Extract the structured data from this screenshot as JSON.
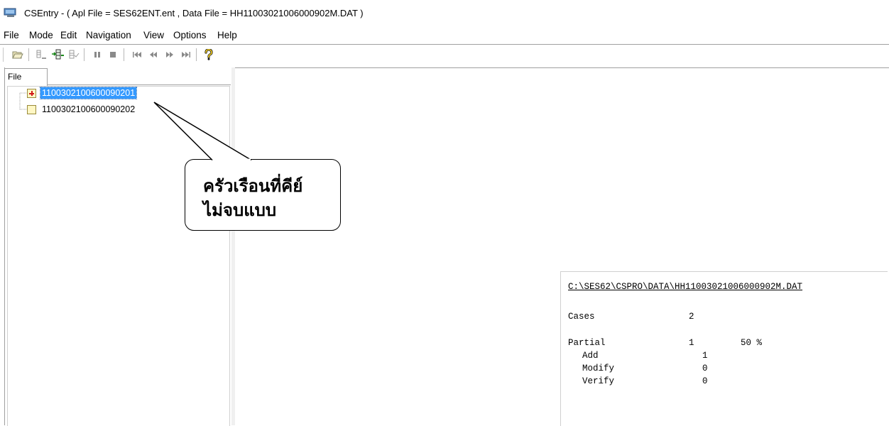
{
  "window": {
    "title": "CSEntry - ( Apl File = SES62ENT.ent , Data File = HH11003021006000902M.DAT )"
  },
  "menu": {
    "items": [
      "File",
      "Mode",
      "Edit",
      "Navigation",
      "View",
      "Options",
      "Help"
    ]
  },
  "toolbar": {
    "buttons": [
      "open-icon",
      "add-case-icon",
      "insert-case-icon",
      "verify-case-icon",
      "pause-icon",
      "stop-icon",
      "first-icon",
      "previous-icon",
      "next-icon",
      "last-icon",
      "help-icon"
    ]
  },
  "left_panel": {
    "tab_label": "File",
    "tree": [
      {
        "label": "1100302100600090201",
        "state": "partial",
        "selected": true
      },
      {
        "label": "1100302100600090202",
        "state": "complete",
        "selected": false
      }
    ]
  },
  "callout": {
    "line1": "ครัวเรือนที่คีย์",
    "line2": "ไม่จบแบบ"
  },
  "stats": {
    "file_path": "C:\\SES62\\CSPRO\\DATA\\HH11003021006000902M.DAT",
    "cases_label": "Cases",
    "cases_value": "2",
    "partial_label": "Partial",
    "partial_value": "1",
    "partial_percent": "50 %",
    "add_label": "Add",
    "add_value": "1",
    "modify_label": "Modify",
    "modify_value": "0",
    "verify_label": "Verify",
    "verify_value": "0"
  }
}
